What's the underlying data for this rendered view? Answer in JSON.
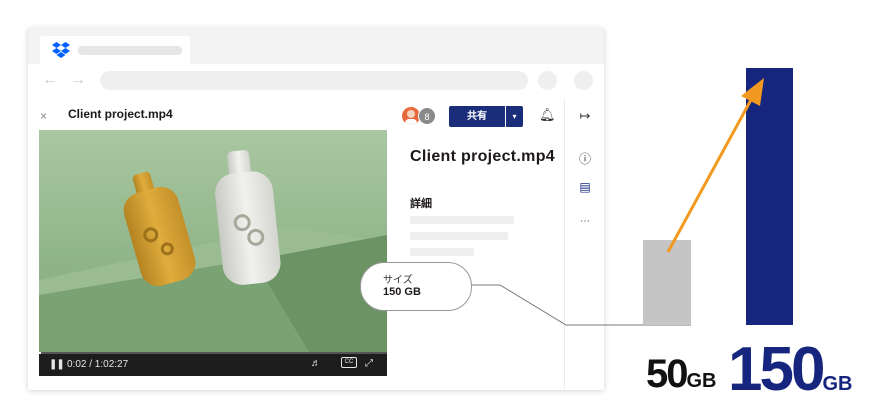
{
  "viewer": {
    "close_glyph": "×",
    "file_title": "Client project.mp4",
    "timecode": "0:02 / 1:02:27",
    "cc_label": "CC"
  },
  "panel": {
    "avatar_count": "8",
    "share_label": "共有",
    "title": "Client project.mp4",
    "details_label": "詳細",
    "size_label": "サイズ",
    "size_value": "150 GB"
  },
  "comparison": {
    "before": {
      "value": "50",
      "unit": "GB"
    },
    "after": {
      "value": "150",
      "unit": "GB"
    }
  },
  "colors": {
    "accent": "#16267f",
    "arrow": "#f29a1f",
    "bar_small": "#c5c5c5"
  },
  "icons": [
    "dropbox-logo-icon",
    "back-arrow-icon",
    "forward-arrow-icon",
    "pause-icon",
    "volume-icon",
    "captions-icon",
    "fullscreen-icon",
    "bell-icon",
    "collapse-panel-icon",
    "info-icon",
    "comment-icon",
    "more-icon"
  ]
}
